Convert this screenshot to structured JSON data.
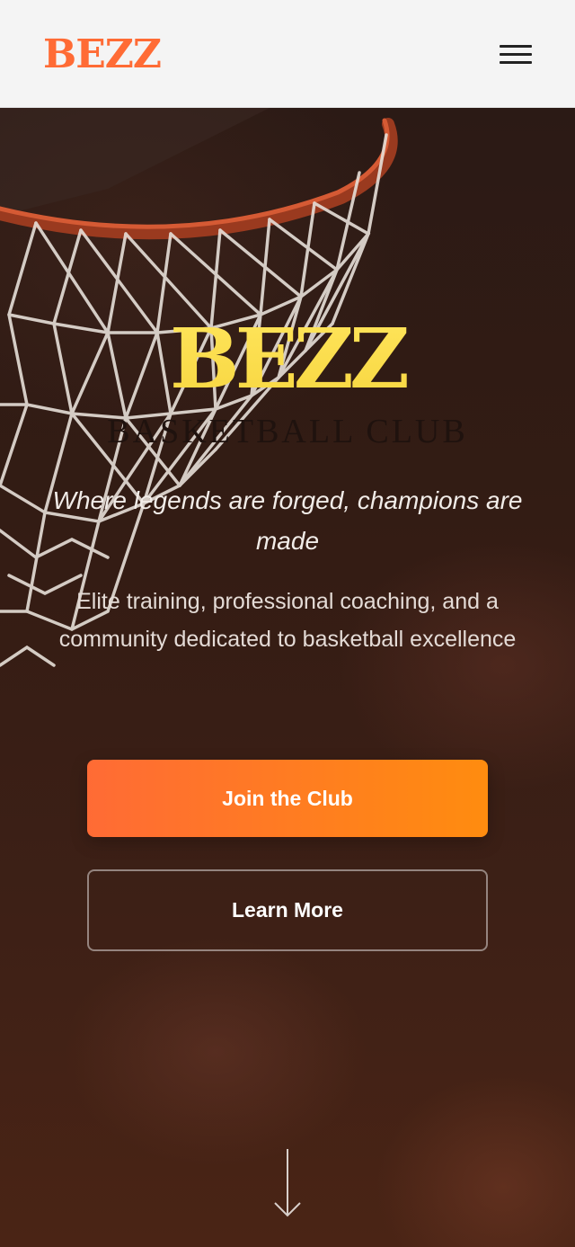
{
  "header": {
    "logo": "BEZZ",
    "menu_icon": "hamburger-menu-icon"
  },
  "hero": {
    "title": "BEZZ",
    "subtitle": "BASKETBALL CLUB",
    "tagline": "Where legends are forged, champions are made",
    "description": "Elite training, professional coaching, and a community dedicated to basketball excellence",
    "primary_button": "Join the Club",
    "secondary_button": "Learn More",
    "scroll_icon": "arrow-down-icon",
    "background_image": "basketball-hoop-image"
  },
  "colors": {
    "brand_orange": "#ff6b35",
    "button_gradient_end": "#ff8c0f",
    "title_yellow": "#ffe55c",
    "header_bg": "#f4f4f4"
  }
}
